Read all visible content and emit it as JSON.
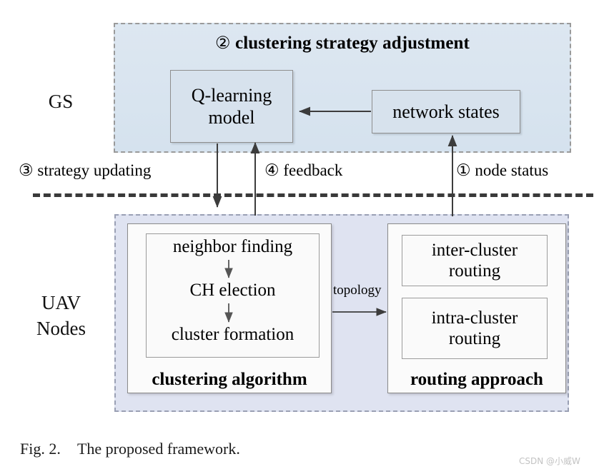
{
  "figure": {
    "caption_label": "Fig. 2.",
    "caption_text": "The proposed framework.",
    "watermark": "CSDN @小威W"
  },
  "side_labels": {
    "gs": "GS",
    "uav": "UAV\nNodes"
  },
  "gs_panel": {
    "title_number": "②",
    "title": "clustering strategy adjustment",
    "qlearning_box": "Q-learning\nmodel",
    "network_states_box": "network states"
  },
  "middle_labels": {
    "strategy_updating": "③ strategy updating",
    "feedback": "④ feedback",
    "node_status": "① node status"
  },
  "uav_panel": {
    "clustering_group": {
      "title": "clustering algorithm",
      "steps": [
        "neighbor finding",
        "CH election",
        "cluster formation"
      ]
    },
    "routing_group": {
      "title": "routing approach",
      "boxes": [
        "inter-cluster\nrouting",
        "intra-cluster\nrouting"
      ]
    },
    "topology_label": "topology"
  },
  "colors": {
    "gs_panel_bg": "#dde7f1",
    "uav_panel_bg": "#dfe3f1",
    "box_bg_gs": "#d7e2ed",
    "box_bg_white": "#fbfbfb",
    "divider": "#3a3a3a",
    "arrow": "#3c3c3c"
  }
}
